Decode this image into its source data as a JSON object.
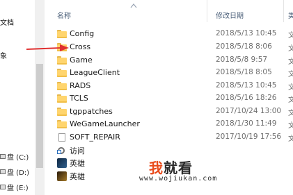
{
  "nav": {
    "items": [
      {
        "label": "文档",
        "icon": "folder-icon"
      },
      {
        "label": "象",
        "icon": "folder-icon"
      },
      {
        "label": "盘 (C:)",
        "icon": "drive-icon"
      },
      {
        "label": "盘 (D:)",
        "icon": "drive-icon"
      },
      {
        "label": "盘 (E:)",
        "icon": "drive-icon"
      }
    ]
  },
  "columns": {
    "name": "名称",
    "date": "修改日期",
    "type_partial": "类"
  },
  "files": [
    {
      "name": "Config",
      "date": "2018/5/13 10:45",
      "type": "文",
      "kind": "folder"
    },
    {
      "name": "Cross",
      "date": "2018/5/18 8:06",
      "type": "文",
      "kind": "folder"
    },
    {
      "name": "Game",
      "date": "2018/5/8 9:57",
      "type": "文",
      "kind": "folder"
    },
    {
      "name": "LeagueClient",
      "date": "2018/5/18 8:05",
      "type": "文",
      "kind": "folder"
    },
    {
      "name": "RADS",
      "date": "2018/5/13 10:45",
      "type": "文",
      "kind": "folder"
    },
    {
      "name": "TCLS",
      "date": "2018/5/16 18:26",
      "type": "文",
      "kind": "folder"
    },
    {
      "name": "tgppatches",
      "date": "2017/10/24 13:00",
      "type": "文",
      "kind": "folder"
    },
    {
      "name": "WeGameLauncher",
      "date": "2018/1/30 11:49",
      "type": "文",
      "kind": "folder"
    },
    {
      "name": "SOFT_REPAIR",
      "date": "2017/10/19 17:56",
      "type": "文",
      "kind": "file"
    },
    {
      "name": "访问",
      "date": "",
      "type": "",
      "kind": "shortcut"
    },
    {
      "name": "英雄",
      "date": "",
      "type": "",
      "kind": "app"
    },
    {
      "name": "英雄",
      "date": "",
      "type": "",
      "kind": "app2"
    }
  ],
  "watermark": {
    "brand_part1": "我",
    "brand_part2": "就看",
    "url": "www.wojiukan.com"
  },
  "colors": {
    "annotation_arrow": "#e03030",
    "folder": "#ffd56e",
    "header_text": "#4c607a"
  }
}
